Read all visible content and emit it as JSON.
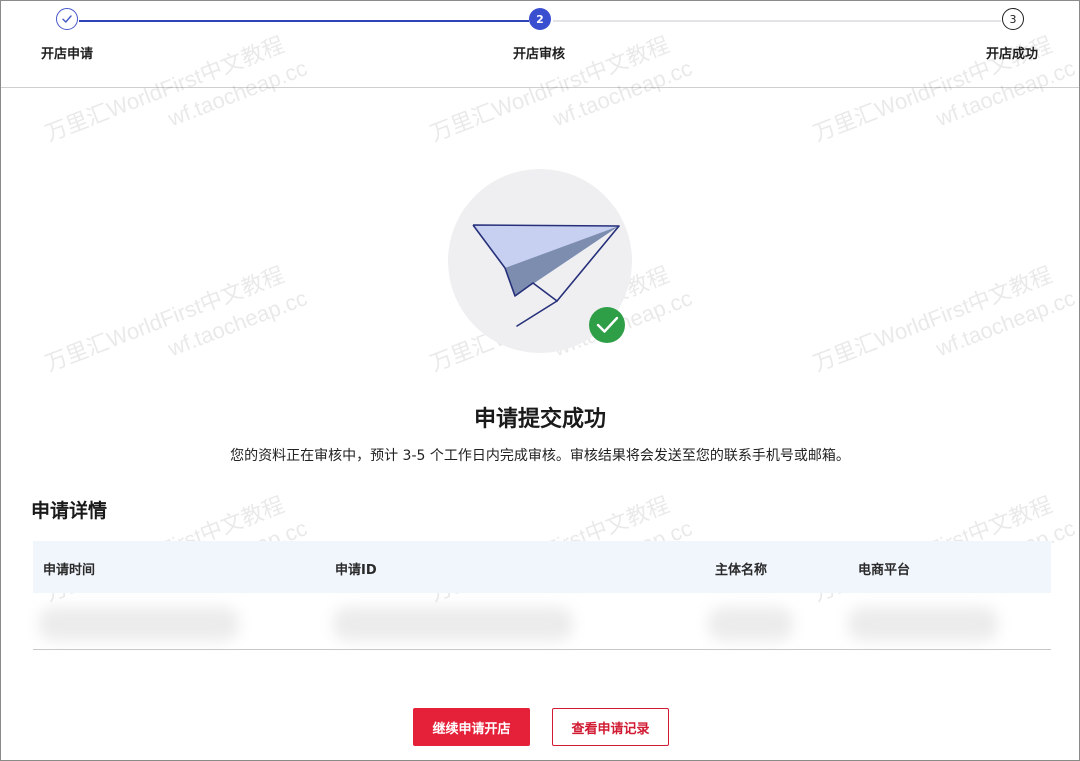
{
  "steps": [
    {
      "label": "开店申请",
      "state": "done",
      "marker": ""
    },
    {
      "label": "开店审核",
      "state": "current",
      "marker": "2"
    },
    {
      "label": "开店成功",
      "state": "todo",
      "marker": "3"
    }
  ],
  "colors": {
    "accent": "#3a4ed0",
    "success": "#2e9e47",
    "danger": "#e5213a",
    "table_head_bg": "#f1f5fc"
  },
  "hero": {
    "icons": [
      "paper-plane-icon",
      "check-circle-icon"
    ],
    "title": "申请提交成功",
    "description": "您的资料正在审核中，预计 3-5 个工作日内完成审核。审核结果将会发送至您的联系手机号或邮箱。"
  },
  "details": {
    "title": "申请详情",
    "columns": [
      "申请时间",
      "申请ID",
      "主体名称",
      "电商平台"
    ]
  },
  "actions": {
    "continue_label": "继续申请开店",
    "records_label": "查看申请记录"
  },
  "watermark": {
    "line1": "万里汇WorldFirst中文教程",
    "line2": "wf.taocheap.cc"
  }
}
